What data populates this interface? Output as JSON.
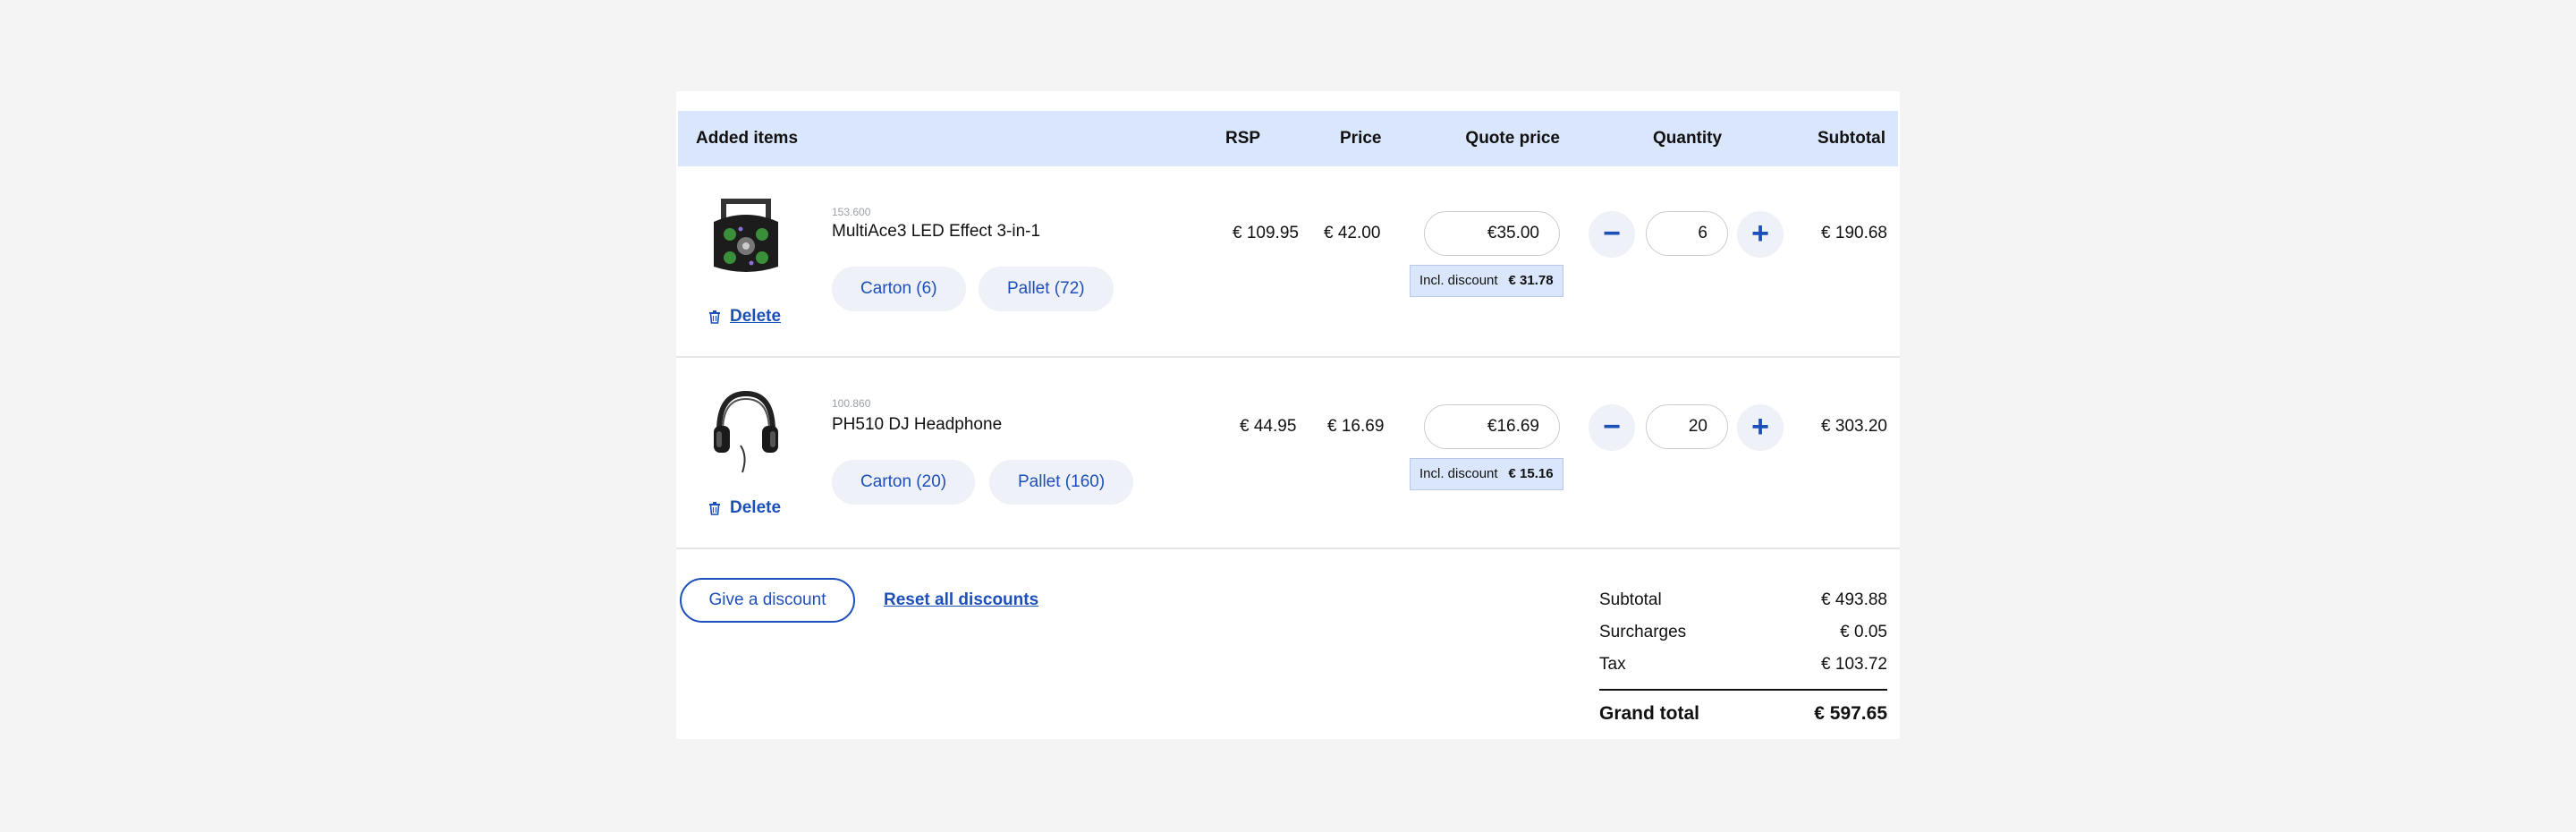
{
  "table": {
    "headers": {
      "items": "Added items",
      "rsp": "RSP",
      "price": "Price",
      "quote": "Quote price",
      "quantity": "Quantity",
      "subtotal": "Subtotal"
    },
    "rows": [
      {
        "sku": "153.600",
        "name": "MultiAce3 LED Effect 3-in-1",
        "rsp": "€ 109.95",
        "price": "€ 42.00",
        "quote_price": "€35.00",
        "discount_label": "Incl. discount",
        "discount_value": "€ 31.78",
        "quantity": "6",
        "subtotal": "€ 190.68",
        "delete_label": "Delete",
        "packs": [
          "Carton (6)",
          "Pallet (72)"
        ]
      },
      {
        "sku": "100.860",
        "name": "PH510 DJ Headphone",
        "rsp": "€ 44.95",
        "price": "€ 16.69",
        "quote_price": "€16.69",
        "discount_label": "Incl. discount",
        "discount_value": "€ 15.16",
        "quantity": "20",
        "subtotal": "€ 303.20",
        "delete_label": "Delete",
        "packs": [
          "Carton (20)",
          "Pallet (160)"
        ]
      }
    ]
  },
  "actions": {
    "give_discount": "Give a discount",
    "reset_discounts": "Reset all discounts"
  },
  "summary": {
    "subtotal_label": "Subtotal",
    "subtotal_value": "€ 493.88",
    "surcharges_label": "Surcharges",
    "surcharges_value": "€ 0.05",
    "tax_label": "Tax",
    "tax_value": "€ 103.72",
    "grand_label": "Grand total",
    "grand_value": "€ 597.65"
  },
  "icons": {
    "minus": "minus-icon",
    "plus": "plus-icon",
    "trash": "trash-icon"
  },
  "colors": {
    "accent": "#1d4fb8",
    "header_bg": "#d9e6fb",
    "chip_bg": "#eef1f7"
  }
}
